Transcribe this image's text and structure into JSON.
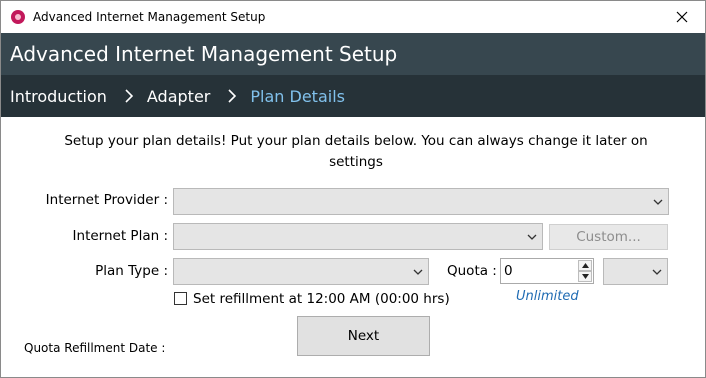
{
  "window": {
    "title": "Advanced Internet Management Setup",
    "app_icon": "app-icon",
    "close_glyph": "✕"
  },
  "header": {
    "title": "Advanced Internet Management Setup"
  },
  "breadcrumb": {
    "steps": [
      {
        "label": "Introduction",
        "state": "done"
      },
      {
        "label": "Adapter",
        "state": "done"
      },
      {
        "label": "Plan Details",
        "state": "active"
      }
    ],
    "separator_icon": "chevron-right-icon"
  },
  "colors": {
    "header_bg": "#37474f",
    "breadcrumb_bg": "#263238",
    "active_step": "#81c1ec",
    "link": "#1f6bb3"
  },
  "intro": {
    "text": "Setup your plan details! Put your plan details below. You can always change it later on settings"
  },
  "form": {
    "provider_label": "Internet Provider :",
    "provider_value": "",
    "plan_label": "Internet Plan :",
    "plan_value": "",
    "custom_button": "Custom...",
    "plan_type_label": "Plan Type :",
    "plan_type_value": "",
    "quota_label": "Quota :",
    "quota_value": "0",
    "quota_unit_value": "",
    "unlimited_link": "Unlimited",
    "refill_checkbox_label": "Set refillment at 12:00 AM (00:00 hrs)",
    "refill_checked": false,
    "refill_date_label": "Quota Refillment Date :",
    "next_button": "Next"
  }
}
